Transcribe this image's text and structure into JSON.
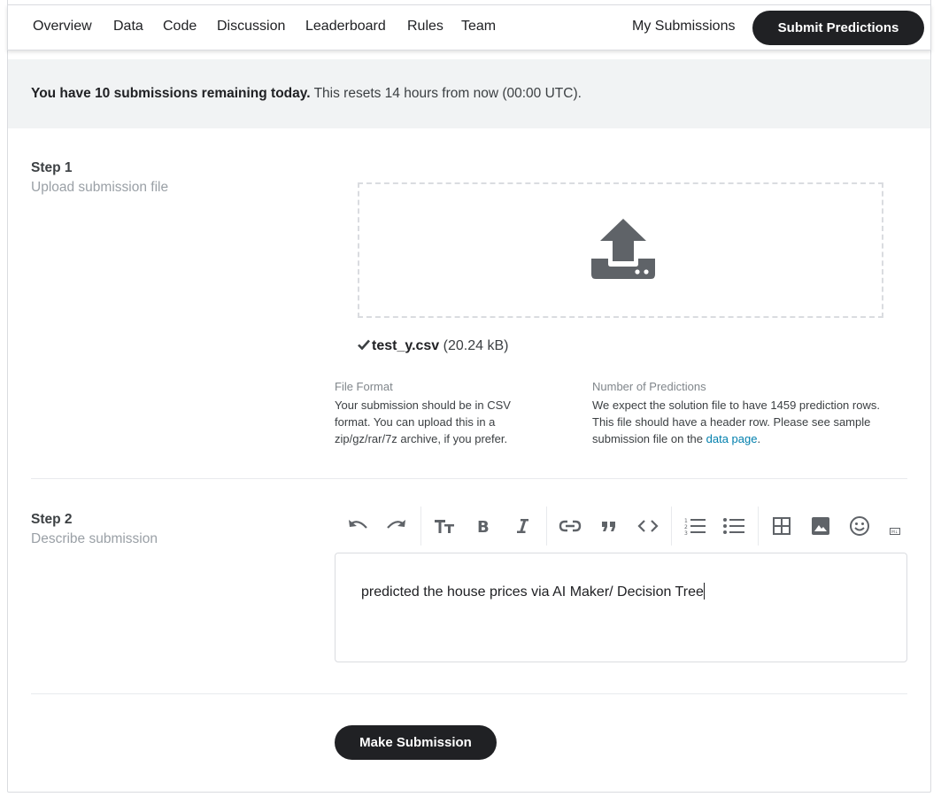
{
  "nav": {
    "tabs": [
      {
        "label": "Overview"
      },
      {
        "label": "Data"
      },
      {
        "label": "Code"
      },
      {
        "label": "Discussion"
      },
      {
        "label": "Leaderboard"
      },
      {
        "label": "Rules"
      },
      {
        "label": "Team"
      }
    ],
    "my_submissions": "My Submissions",
    "submit_predictions": "Submit Predictions"
  },
  "banner": {
    "bold": "You have 10 submissions remaining today.",
    "rest": " This resets 14 hours from now (00:00 UTC)."
  },
  "step1": {
    "title": "Step 1",
    "subtitle": "Upload submission file",
    "upload_icon": "upload-icon",
    "file": {
      "name": "test_y.csv",
      "size": "(20.24 kB)"
    },
    "file_format": {
      "heading": "File Format",
      "lines": [
        "Your submission should be in CSV",
        "format. You can upload this in a",
        "zip/gz/rar/7z archive, if you prefer."
      ]
    },
    "num_predictions": {
      "heading": "Number of Predictions",
      "lines": [
        "We expect the solution file to have 1459 prediction rows.",
        "This file should have a header row. Please see sample"
      ],
      "last_line_prefix": "submission file on the ",
      "link": "data page",
      "last_line_suffix": "."
    }
  },
  "step2": {
    "title": "Step 2",
    "subtitle": "Describe submission",
    "toolbar": [
      "undo-icon",
      "redo-icon",
      "heading-icon",
      "bold-icon",
      "italic-icon",
      "link-icon",
      "quote-icon",
      "code-icon",
      "ordered-list-icon",
      "bullet-list-icon",
      "table-icon",
      "image-icon",
      "emoji-icon",
      "markdown-icon"
    ],
    "editor_text": "predicted the house prices via AI Maker/ Decision Tree"
  },
  "make_submission": "Make Submission",
  "colors": {
    "primary_button": "#202124",
    "link": "#007fad",
    "banner_bg": "#f1f3f4"
  }
}
